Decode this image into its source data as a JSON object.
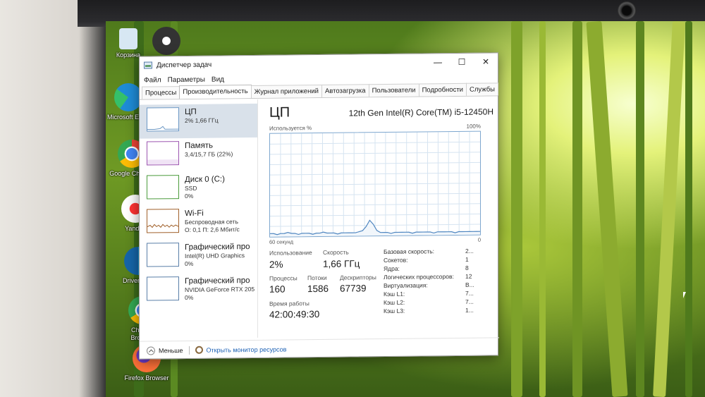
{
  "desktop_icons": [
    {
      "label": "Корзина",
      "color": "#cfe3f2"
    },
    {
      "label": "",
      "color": "#3b3b3b"
    },
    {
      "label": "Microsoft Edge",
      "color": "#1e8bd6"
    },
    {
      "label": "Google Chrome",
      "color": "#e53935"
    },
    {
      "label": "Yandex",
      "color": "#ffffff"
    },
    {
      "label": "DriverPack",
      "color": "#1e9bd6"
    },
    {
      "label": "Chrome Browser",
      "color": "#e53935"
    },
    {
      "label": "Firefox Browser",
      "color": "#ff7139"
    }
  ],
  "window": {
    "title": "Диспетчер задач",
    "controls": {
      "minimize": "—",
      "maximize": "☐",
      "close": "✕"
    }
  },
  "menu": [
    "Файл",
    "Параметры",
    "Вид"
  ],
  "tabs": [
    {
      "label": "Процессы",
      "active": false
    },
    {
      "label": "Производительность",
      "active": true
    },
    {
      "label": "Журнал приложений",
      "active": false
    },
    {
      "label": "Автозагрузка",
      "active": false
    },
    {
      "label": "Пользователи",
      "active": false
    },
    {
      "label": "Подробности",
      "active": false
    },
    {
      "label": "Службы",
      "active": false
    }
  ],
  "sidebar": [
    {
      "title": "ЦП",
      "line1": "2% 1,66 ГГц",
      "line2": "",
      "line3": ""
    },
    {
      "title": "Память",
      "line1": "3,4/15,7 ГБ (22%)",
      "line2": "",
      "line3": ""
    },
    {
      "title": "Диск 0 (C:)",
      "line1": "SSD",
      "line2": "0%",
      "line3": ""
    },
    {
      "title": "Wi-Fi",
      "line1": "Беспроводная сеть",
      "line2": "О: 0,1 П: 2,6 Мбит/с",
      "line3": ""
    },
    {
      "title": "Графический про",
      "line1": "Intel(R) UHD Graphics",
      "line2": "0%",
      "line3": ""
    },
    {
      "title": "Графический про",
      "line1": "NVIDIA GeForce RTX 205",
      "line2": "0%",
      "line3": ""
    }
  ],
  "cpu": {
    "title": "ЦП",
    "model": "12th Gen Intel(R) Core(TM) i5-12450H",
    "graph_label": "Используется %",
    "graph_max": "100%",
    "graph_time": "60 секунд",
    "graph_min": "0",
    "graph_series": [
      3,
      3,
      2,
      3,
      3,
      4,
      3,
      3,
      2,
      3,
      3,
      3,
      2,
      3,
      3,
      4,
      3,
      3,
      3,
      2,
      3,
      3,
      3,
      3,
      3,
      4,
      5,
      9,
      15,
      11,
      5,
      3,
      3,
      3,
      2,
      3,
      3,
      3,
      3,
      3,
      2,
      3,
      3,
      3,
      3,
      3,
      2,
      3,
      3,
      3,
      3,
      3,
      2,
      3,
      3,
      3,
      3,
      3,
      3,
      3
    ]
  },
  "stats": {
    "usage_label": "Использование",
    "usage_value": "2%",
    "speed_label": "Скорость",
    "speed_value": "1,66 ГГц",
    "processes_label": "Процессы",
    "processes_value": "160",
    "threads_label": "Потоки",
    "threads_value": "1586",
    "handles_label": "Дескрипторы",
    "handles_value": "67739",
    "uptime_label": "Время работы",
    "uptime_value": "42:00:49:30"
  },
  "specs": [
    {
      "label": "Базовая скорость:",
      "value": "2..."
    },
    {
      "label": "Сокетов:",
      "value": "1"
    },
    {
      "label": "Ядра:",
      "value": "8"
    },
    {
      "label": "Логических процессоров:",
      "value": "12"
    },
    {
      "label": "Виртуализация:",
      "value": "В..."
    },
    {
      "label": "Кэш L1:",
      "value": "7..."
    },
    {
      "label": "Кэш L2:",
      "value": "7..."
    },
    {
      "label": "Кэш L3:",
      "value": "1..."
    }
  ],
  "footer": {
    "less": "Меньше",
    "resource_monitor": "Открыть монитор ресурсов"
  }
}
